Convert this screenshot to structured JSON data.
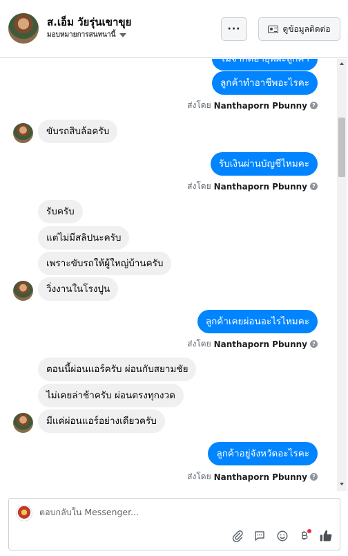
{
  "header": {
    "name": "ส.เอ็ม วัยรุ่นเขาขุย",
    "subtitle": "มอบหมายการสนทนานี้",
    "more_label": "···",
    "contact_label": "ดูข้อมูลติดต่อ"
  },
  "thread": {
    "partial_top": "ไม่จำกัดอายุพี่ผะลูกค้า",
    "messages": [
      {
        "dir": "out",
        "text": "ลูกค้าทำอาชีพอะไรคะ"
      },
      {
        "dir": "in",
        "text": "ขับรถสิบล้อครับ"
      },
      {
        "dir": "out",
        "text": "รับเงินผ่านบัญชีไหมคะ"
      },
      {
        "dir": "in",
        "text": "รับครับ"
      },
      {
        "dir": "in",
        "text": "แต่ไม่มีสลิปนะครับ"
      },
      {
        "dir": "in",
        "text": "เพราะขับรถให้ผู้ใหญ่บ้านครับ"
      },
      {
        "dir": "in",
        "text": "วิ่งงานในโรงปูน"
      },
      {
        "dir": "out",
        "text": "ลูกค้าเคยผ่อนอะไรไหมคะ"
      },
      {
        "dir": "in",
        "text": "ตอนนี้ผ่อนแอร์ครับ ผ่อนกับสยามชัย"
      },
      {
        "dir": "in",
        "text": "ไม่เคยล่าช้าครับ ผ่อนตรงทุกงวด"
      },
      {
        "dir": "in",
        "text": "มีแค่ผ่อนแอร์อย่างเดียวครับ"
      },
      {
        "dir": "out",
        "text": "ลูกค้าอยู่จังหวัดอะไรคะ"
      }
    ],
    "sent_by_prefix": "ส่งโดย",
    "sent_by_name": "Nanthaporn Pbunny",
    "info_glyph": "?"
  },
  "composer": {
    "placeholder": "ตอบกลับใน Messenger...",
    "icons": [
      "paperclip-icon",
      "saved-replies-icon",
      "emoji-icon",
      "baht-payment-icon",
      "like-icon"
    ]
  },
  "colors": {
    "outgoing_bubble": "#0084ff",
    "incoming_bubble": "#f0f0f0",
    "accent_dot": "#f02849"
  }
}
